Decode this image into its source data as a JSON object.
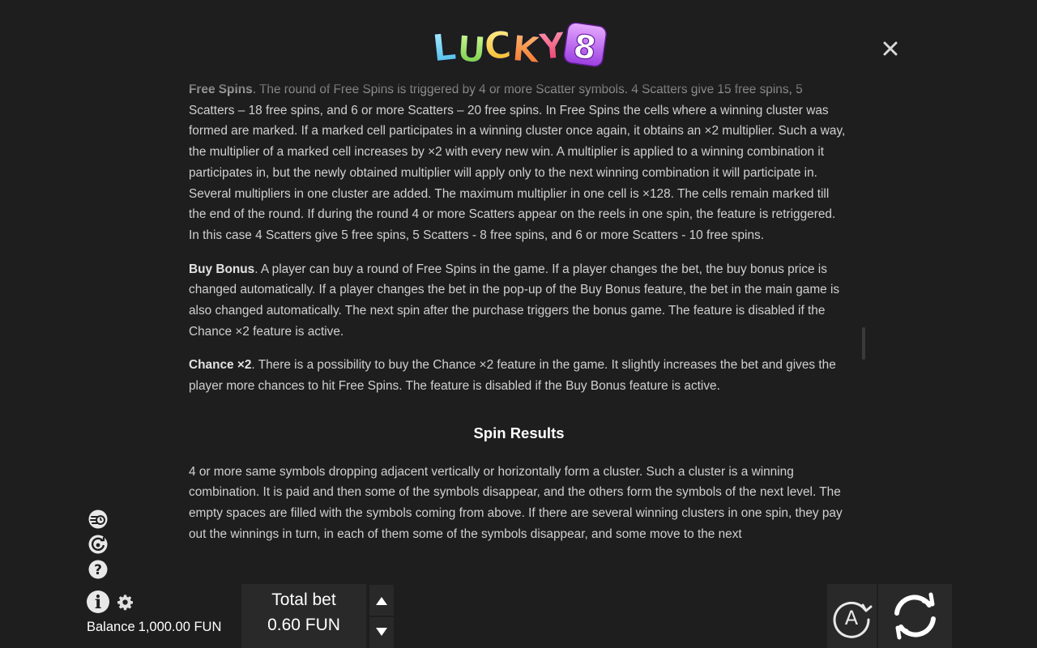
{
  "header": {
    "logo_text": "LUCKY8",
    "close_icon": "close-icon"
  },
  "rules": {
    "free_spins": {
      "title": "Free Spins",
      "text": ". The round of Free Spins is triggered by 4 or more Scatter symbols. 4 Scatters give 15 free spins, 5 Scatters – 18 free spins, and 6 or more Scatters – 20 free spins. In Free Spins the cells where a winning cluster was formed are marked. If a marked cell participates in a winning cluster once again, it obtains an ×2 multiplier. Such a way, the multiplier of a marked cell increases by ×2 with every new win. A multiplier is applied to a winning combination it participates in, but the newly obtained multiplier will apply only to the next winning combination it will participate in. Several multipliers in one cluster are added. The maximum multiplier in one cell is ×128. The cells remain marked till the end of the round. If during the round 4 or more Scatters appear on the reels in one spin, the feature is retriggered. In this case 4 Scatters give 5 free spins, 5 Scatters - 8 free spins, and 6 or more Scatters - 10 free spins."
    },
    "buy_bonus": {
      "title": "Buy Bonus",
      "text": ". A player can buy a round of Free Spins in the game. If a player changes the bet, the buy bonus price is changed automatically. If a player changes the bet in the pop-up of the Buy Bonus feature, the bet in the main game is also changed automatically. The next spin after the purchase triggers the bonus game. The feature is disabled if the Chance ×2 feature is active."
    },
    "chance_x2": {
      "title": "Chance ×2",
      "text": ". There is a possibility to buy the Chance ×2 feature in the game. It slightly increases the bet and gives the player more chances to hit Free Spins. The feature is disabled if the Buy Bonus feature is active."
    },
    "spin_results": {
      "title": "Spin Results",
      "text": "4 or more same symbols dropping adjacent vertically or horizontally form a cluster. Such a cluster is a winning combination. It is paid and then some of the symbols disappear, and the others form the symbols of the next level. The empty spaces are filled with the symbols coming from above. If there are several winning clusters in one spin, they pay out the winnings in turn, in each of them some of the symbols disappear, and some move to the next"
    }
  },
  "sidebar_icons": [
    "turbo-icon",
    "autoplay-history-icon",
    "help-icon",
    "info-icon",
    "settings-icon"
  ],
  "footer": {
    "balance_label": "Balance",
    "balance_value": "1,000.00 FUN",
    "total_bet_label": "Total bet",
    "total_bet_value": "0.60 FUN",
    "auto_label": "A",
    "spin_icon": "spin-icon"
  },
  "colors": {
    "background": "#1e1e1e",
    "panel": "#292929",
    "text": "#d0d0d0",
    "accent_white": "#ffffff"
  }
}
